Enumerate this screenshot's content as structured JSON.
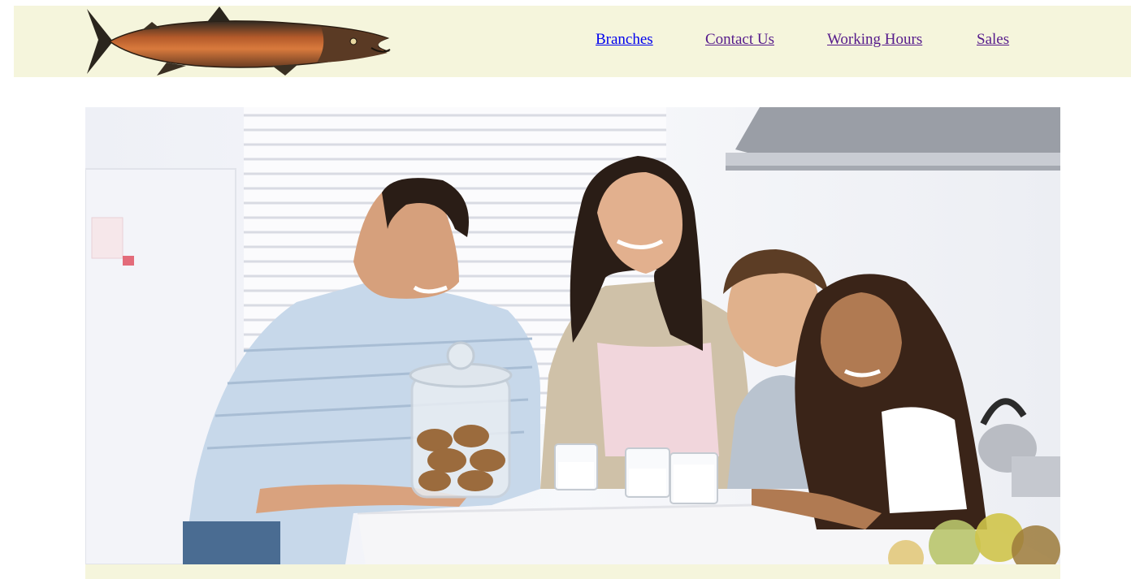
{
  "header": {
    "logo_icon": "salmon-fish-logo",
    "nav": [
      {
        "label": "Branches",
        "visited": false
      },
      {
        "label": "Contact Us",
        "visited": true
      },
      {
        "label": "Working Hours",
        "visited": true
      },
      {
        "label": "Sales",
        "visited": true
      }
    ]
  },
  "hero": {
    "image": "family-in-kitchen-photo"
  },
  "colors": {
    "header_bg": "#f5f5dc",
    "link": "#0000ee",
    "link_visited": "#551a8b"
  }
}
